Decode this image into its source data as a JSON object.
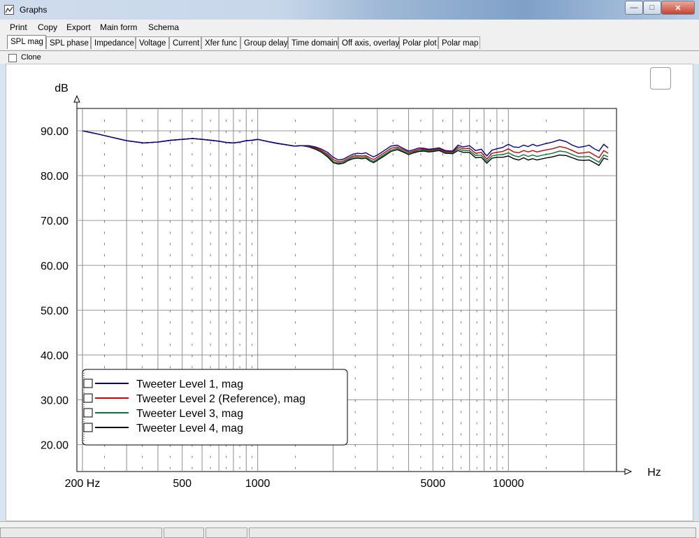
{
  "window": {
    "title": "Graphs"
  },
  "menu": [
    "Print",
    "Copy",
    "Export",
    "Main form",
    "Schema"
  ],
  "tabs": [
    "SPL mag",
    "SPL phase",
    "Impedance",
    "Voltage",
    "Current",
    "Xfer func",
    "Group delay",
    "Time domain",
    "Off axis, overlay",
    "Polar plot",
    "Polar map"
  ],
  "active_tab": "SPL mag",
  "clone": {
    "label": "Clone",
    "checked": false
  },
  "icons": {
    "app": "graph-app-icon",
    "minimize": "minimize-icon",
    "maximize": "maximize-icon",
    "close": "close-icon"
  },
  "chart_data": {
    "type": "line",
    "ylabel": "dB",
    "xlabel": "Hz",
    "x_scale": "log",
    "xlim": [
      190,
      27000
    ],
    "ylim": [
      14,
      95
    ],
    "y_ticks": [
      20,
      30,
      40,
      50,
      60,
      70,
      80,
      90
    ],
    "y_tick_labels": [
      "20.00",
      "30.00",
      "40.00",
      "50.00",
      "60.00",
      "70.00",
      "80.00",
      "90.00"
    ],
    "x_tick_values": [
      200,
      500,
      1000,
      5000,
      10000
    ],
    "x_tick_labels": [
      "200 Hz",
      "500",
      "1000",
      "5000",
      "10000"
    ],
    "grid": true,
    "legend_position": "bottom-left",
    "x": [
      200,
      230,
      260,
      300,
      350,
      400,
      450,
      500,
      550,
      600,
      650,
      700,
      750,
      800,
      850,
      900,
      950,
      1000,
      1100,
      1200,
      1300,
      1400,
      1500,
      1600,
      1700,
      1800,
      1900,
      2000,
      2100,
      2200,
      2300,
      2400,
      2500,
      2600,
      2700,
      2800,
      2900,
      3000,
      3200,
      3400,
      3600,
      3800,
      4000,
      4200,
      4400,
      4600,
      4800,
      5000,
      5300,
      5600,
      6000,
      6300,
      6600,
      7000,
      7400,
      7800,
      8200,
      8600,
      9000,
      9500,
      10000,
      10500,
      11000,
      11500,
      12000,
      12500,
      13000,
      14000,
      15000,
      16000,
      17000,
      18000,
      19000,
      20000,
      21000,
      22000,
      23000,
      24000,
      25000
    ],
    "series": [
      {
        "name": "Tweeter Level 1, mag",
        "color": "#00008b",
        "values": [
          90,
          89.3,
          88.6,
          87.8,
          87.3,
          87.5,
          87.9,
          88.1,
          88.3,
          88.1,
          87.9,
          87.7,
          87.4,
          87.3,
          87.5,
          87.8,
          87.9,
          88.1,
          87.6,
          87.2,
          86.9,
          86.6,
          86.7,
          86.7,
          86.4,
          85.9,
          85.2,
          84.1,
          83.5,
          83.7,
          84.3,
          84.8,
          85.0,
          84.9,
          85.1,
          84.6,
          84.2,
          84.6,
          85.6,
          86.6,
          86.8,
          86.1,
          85.5,
          85.8,
          86.2,
          86.1,
          85.9,
          86.0,
          86.2,
          85.6,
          85.5,
          86.8,
          86.4,
          86.7,
          85.6,
          85.9,
          84.4,
          85.7,
          86.0,
          86.3,
          87.0,
          86.4,
          86.3,
          86.8,
          86.5,
          87.0,
          86.6,
          87.1,
          87.5,
          88.0,
          87.6,
          86.8,
          86.3,
          86.5,
          86.8,
          86.0,
          85.5,
          87.0,
          86.2
        ]
      },
      {
        "name": "Tweeter Level 2 (Reference), mag",
        "color": "#cc0000",
        "values": [
          90,
          89.3,
          88.6,
          87.8,
          87.3,
          87.5,
          87.9,
          88.1,
          88.3,
          88.1,
          87.9,
          87.7,
          87.4,
          87.3,
          87.5,
          87.8,
          87.9,
          88.1,
          87.6,
          87.2,
          86.9,
          86.6,
          86.7,
          86.6,
          86.2,
          85.6,
          84.8,
          83.6,
          83.1,
          83.3,
          83.9,
          84.4,
          84.5,
          84.4,
          84.5,
          84.0,
          83.6,
          84.1,
          85.1,
          86.1,
          86.4,
          85.8,
          85.2,
          85.5,
          85.9,
          85.9,
          85.7,
          85.8,
          86.0,
          85.4,
          85.3,
          86.4,
          86.0,
          86.1,
          85.0,
          85.2,
          83.7,
          85.0,
          85.2,
          85.4,
          86.0,
          85.3,
          85.1,
          85.6,
          85.3,
          85.6,
          85.3,
          85.7,
          86.0,
          86.5,
          86.2,
          85.6,
          85.0,
          85.1,
          85.3,
          84.6,
          84.0,
          85.6,
          85.0
        ]
      },
      {
        "name": "Tweeter Level 3, mag",
        "color": "#007a3d",
        "values": [
          90,
          89.3,
          88.6,
          87.8,
          87.3,
          87.5,
          87.9,
          88.1,
          88.3,
          88.1,
          87.9,
          87.7,
          87.4,
          87.3,
          87.5,
          87.8,
          87.9,
          88.1,
          87.6,
          87.2,
          86.9,
          86.6,
          86.7,
          86.5,
          86.1,
          85.4,
          84.5,
          83.2,
          82.8,
          83.0,
          83.6,
          84.1,
          84.2,
          84.1,
          84.2,
          83.6,
          83.2,
          83.7,
          84.7,
          85.7,
          86.1,
          85.5,
          84.9,
          85.3,
          85.6,
          85.7,
          85.5,
          85.6,
          85.8,
          85.2,
          85.1,
          86.0,
          85.6,
          85.6,
          84.5,
          84.6,
          83.2,
          84.4,
          84.6,
          84.7,
          85.1,
          84.5,
          84.2,
          84.7,
          84.3,
          84.6,
          84.3,
          84.7,
          85.0,
          85.5,
          85.3,
          84.7,
          84.2,
          84.2,
          84.3,
          83.6,
          83.0,
          84.6,
          84.2
        ]
      },
      {
        "name": "Tweeter Level 4, mag",
        "color": "#000000",
        "values": [
          90,
          89.3,
          88.6,
          87.8,
          87.3,
          87.5,
          87.9,
          88.1,
          88.3,
          88.1,
          87.9,
          87.7,
          87.4,
          87.3,
          87.5,
          87.8,
          87.9,
          88.1,
          87.6,
          87.2,
          86.9,
          86.6,
          86.7,
          86.4,
          85.9,
          85.2,
          84.2,
          82.9,
          82.6,
          82.8,
          83.4,
          83.8,
          83.9,
          83.8,
          83.9,
          83.3,
          82.9,
          83.4,
          84.4,
          85.4,
          85.8,
          85.3,
          84.7,
          85.1,
          85.4,
          85.5,
          85.3,
          85.4,
          85.6,
          85.0,
          84.9,
          85.6,
          85.2,
          85.2,
          84.0,
          84.1,
          82.8,
          83.9,
          84.1,
          84.1,
          84.4,
          83.8,
          83.5,
          84.0,
          83.5,
          83.8,
          83.5,
          83.9,
          84.2,
          84.6,
          84.5,
          84.0,
          83.5,
          83.4,
          83.5,
          82.9,
          82.3,
          83.9,
          83.6
        ]
      }
    ]
  }
}
